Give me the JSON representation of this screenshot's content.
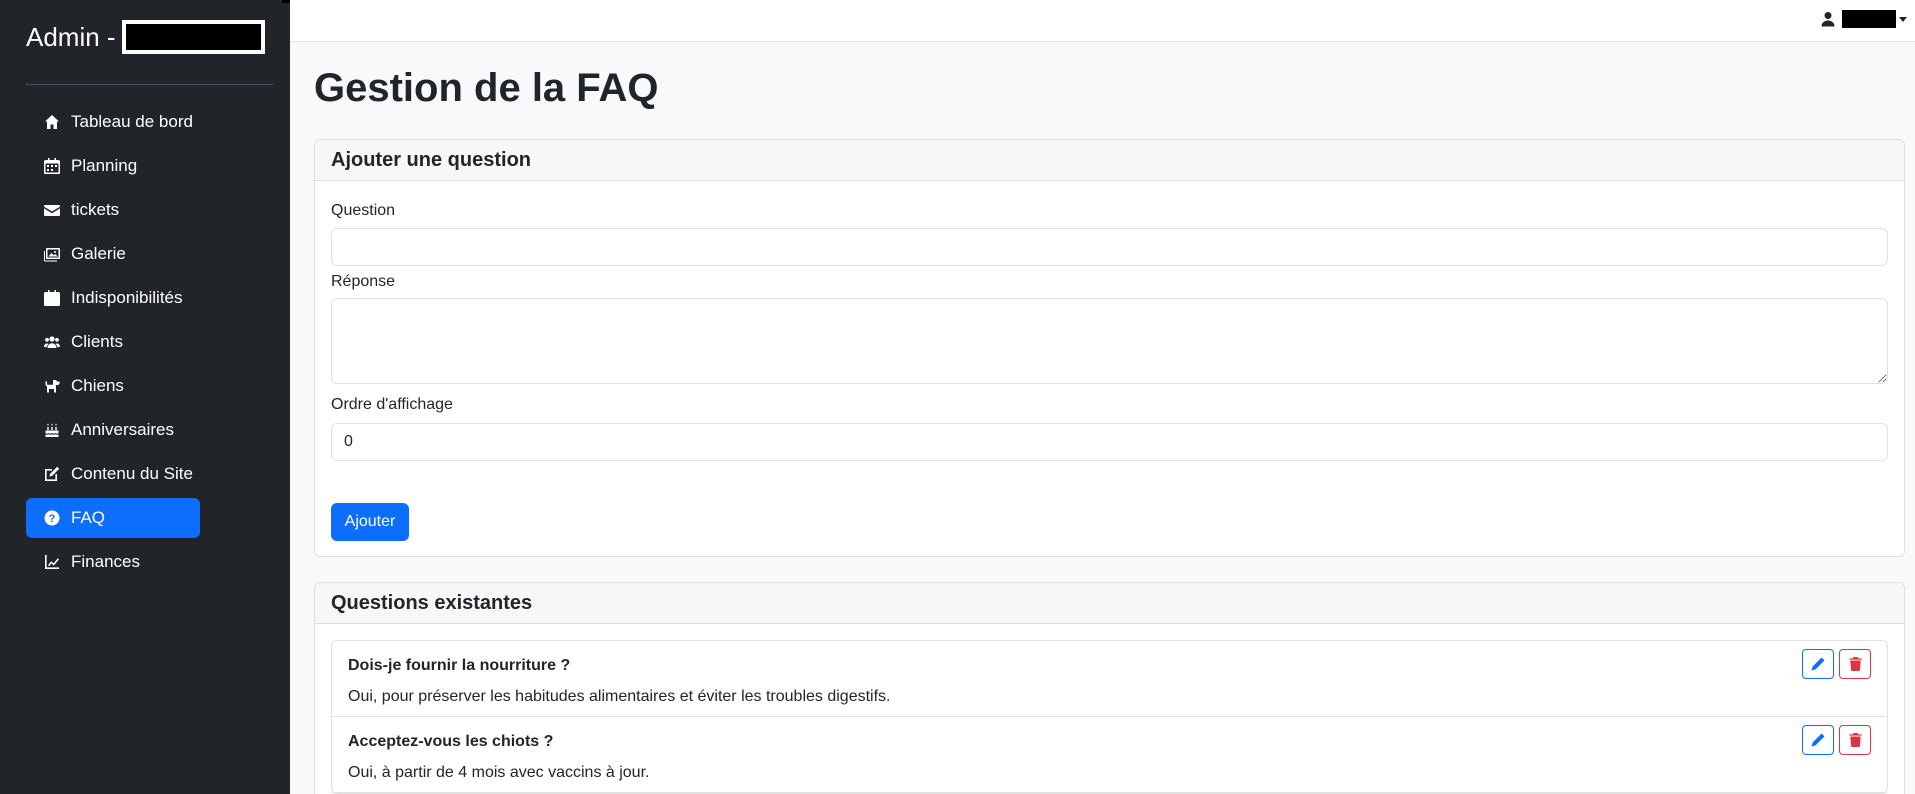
{
  "brand": {
    "title": "Admin -"
  },
  "sidebar": {
    "items": [
      {
        "label": "Tableau de bord",
        "icon": "home-icon"
      },
      {
        "label": "Planning",
        "icon": "calendar-icon"
      },
      {
        "label": "tickets",
        "icon": "envelope-icon"
      },
      {
        "label": "Galerie",
        "icon": "images-icon"
      },
      {
        "label": "Indisponibilités",
        "icon": "calendar-x-icon"
      },
      {
        "label": "Clients",
        "icon": "users-icon"
      },
      {
        "label": "Chiens",
        "icon": "dog-icon"
      },
      {
        "label": "Anniversaires",
        "icon": "cake-icon"
      },
      {
        "label": "Contenu du Site",
        "icon": "edit-icon"
      },
      {
        "label": "FAQ",
        "icon": "question-circle-icon",
        "active": true
      },
      {
        "label": "Finances",
        "icon": "chart-line-icon"
      }
    ]
  },
  "page": {
    "title": "Gestion de la FAQ"
  },
  "add_form": {
    "header": "Ajouter une question",
    "question_label": "Question",
    "question_value": "",
    "answer_label": "Réponse",
    "answer_value": "",
    "order_label": "Ordre d'affichage",
    "order_value": "0",
    "submit_label": "Ajouter"
  },
  "existing": {
    "header": "Questions existantes",
    "items": [
      {
        "question": "Dois-je fournir la nourriture ?",
        "answer": "Oui, pour préserver les habitudes alimentaires et éviter les troubles digestifs."
      },
      {
        "question": "Acceptez-vous les chiots ?",
        "answer": "Oui, à partir de 4 mois avec vaccins à jour."
      }
    ]
  },
  "colors": {
    "sidebar_bg": "#212529",
    "accent": "#0d6efd",
    "danger": "#dc3545"
  }
}
